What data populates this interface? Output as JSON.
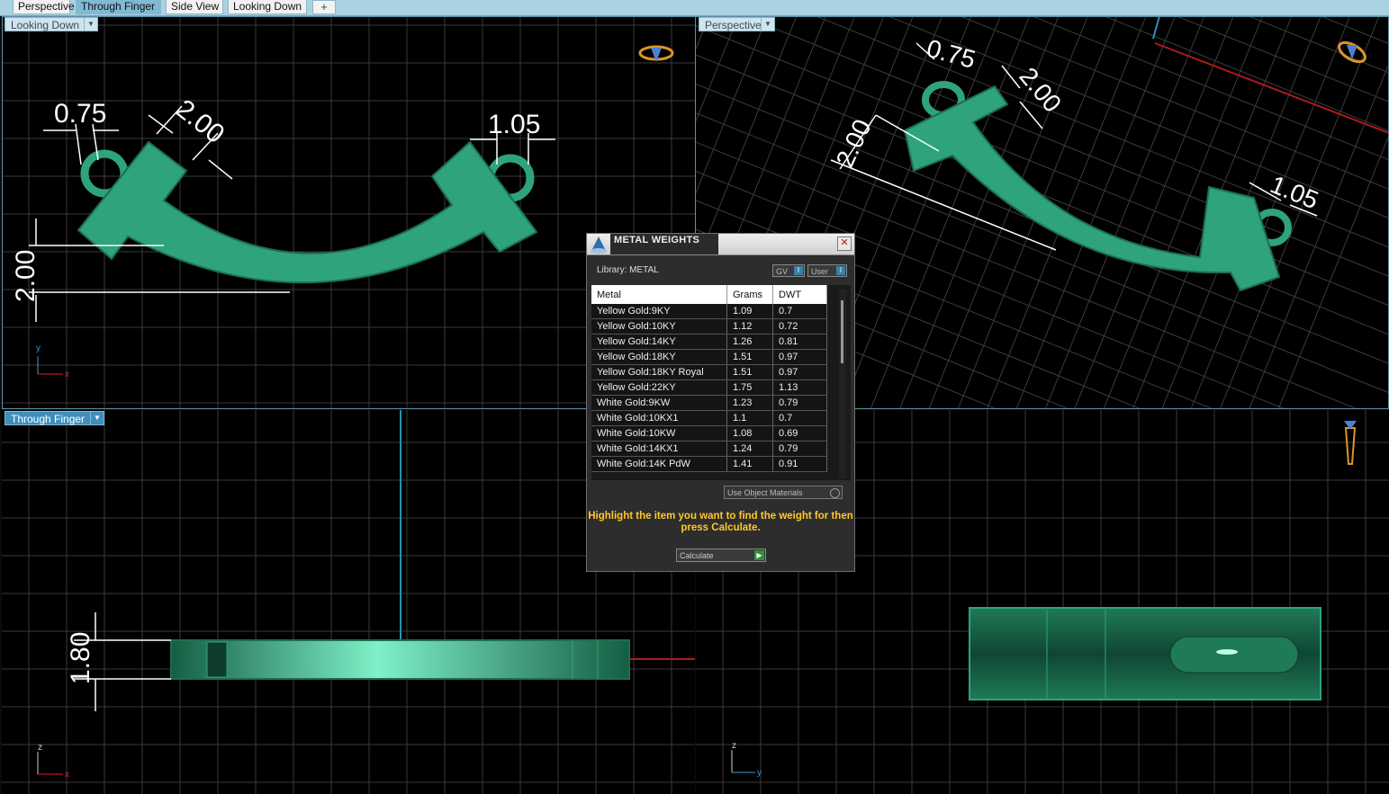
{
  "tabs": [
    "Perspective",
    "Through Finger",
    "Side View",
    "Looking Down"
  ],
  "tab_add": "+",
  "viewports": {
    "top_left": {
      "label": "Looking Down",
      "dims": [
        "0.75",
        "2.00",
        "1.05",
        "2.00"
      ],
      "axes": [
        "y",
        "x"
      ]
    },
    "top_right": {
      "label": "Perspective",
      "dims": [
        "0.75",
        "2.00",
        "2.00",
        "1.05"
      ]
    },
    "bottom_left": {
      "label": "Through Finger",
      "dims": [
        "1.80"
      ],
      "axes": [
        "z",
        "x"
      ]
    },
    "bottom_right": {
      "axes": [
        "z",
        "y"
      ]
    }
  },
  "dialog": {
    "title": "METAL WEIGHTS",
    "library_label": "Library: METAL",
    "toggle_gv": "GV",
    "toggle_user": "User",
    "toggle_glyph": "I",
    "close_glyph": "✕",
    "columns": [
      "Metal",
      "Grams",
      "DWT"
    ],
    "rows": [
      [
        "Yellow Gold:9KY",
        "1.09",
        "0.7"
      ],
      [
        "Yellow Gold:10KY",
        "1.12",
        "0.72"
      ],
      [
        "Yellow Gold:14KY",
        "1.26",
        "0.81"
      ],
      [
        "Yellow Gold:18KY",
        "1.51",
        "0.97"
      ],
      [
        "Yellow Gold:18KY Royal",
        "1.51",
        "0.97"
      ],
      [
        "Yellow Gold:22KY",
        "1.75",
        "1.13"
      ],
      [
        "White Gold:9KW",
        "1.23",
        "0.79"
      ],
      [
        "White Gold:10KX1",
        "1.1",
        "0.7"
      ],
      [
        "White Gold:10KW",
        "1.08",
        "0.69"
      ],
      [
        "White Gold:14KX1",
        "1.24",
        "0.79"
      ],
      [
        "White Gold:14K PdW",
        "1.41",
        "0.91"
      ]
    ],
    "use_object_materials": "Use Object Materials",
    "hint": "Highlight the item you want to find the weight for then press Calculate.",
    "calculate_label": "Calculate",
    "calculate_glyph": "▶"
  },
  "colors": {
    "model": "#2fa37a",
    "model_dark": "#1d6e50",
    "grid": "#3a3a3a",
    "accent": "#3e8fbd",
    "hint": "#ffc82a"
  }
}
